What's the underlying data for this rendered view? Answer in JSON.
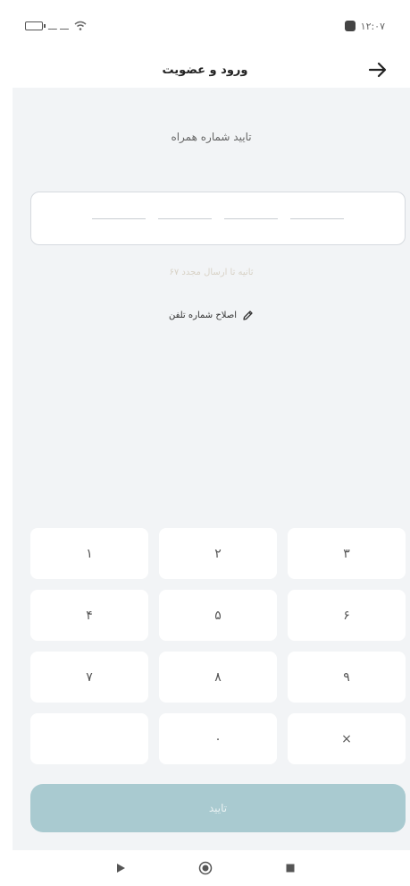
{
  "status_bar": {
    "left_text": "ـــ ـــ",
    "time": "۱۲:۰۷"
  },
  "header": {
    "title": "ورود و عضویت",
    "back_icon": "arrow-right-icon"
  },
  "otp": {
    "title": "تایید شماره همراه",
    "resend_text": "۶۷ ثانیه تا ارسال مجدد",
    "edit_phone_label": "اصلاح شماره تلفن",
    "edit_icon": "pencil-icon"
  },
  "keypad": {
    "keys": [
      "۱",
      "۲",
      "۳",
      "۴",
      "۵",
      "۶",
      "۷",
      "۸",
      "۹",
      "",
      "۰",
      "×"
    ]
  },
  "submit": {
    "label": "تایید"
  },
  "colors": {
    "background": "#f2f4f6",
    "submit_disabled": "#a9cad0",
    "key_bg": "#ffffff"
  }
}
